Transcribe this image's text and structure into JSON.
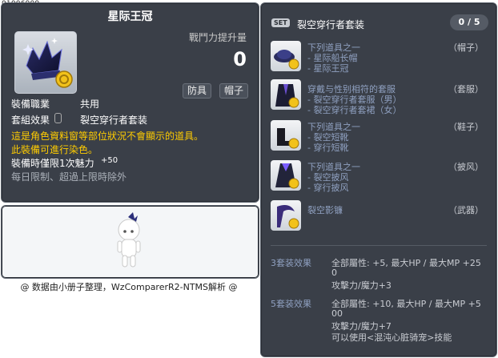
{
  "item_id": "01006909",
  "item": {
    "name": "星际王冠",
    "power_label": "戰鬥力提升量",
    "power_value": "0",
    "tags": [
      "防具",
      "帽子"
    ],
    "job_label": "裝備職業",
    "job_value": "共用",
    "set_label": "套組效果",
    "set_value": "裂空穿行者套装",
    "notice_lines": [
      "這是角色資料窗等部位狀況不會顯示的道具。",
      "此裝備可進行染色。"
    ],
    "charm_label": "裝備時僅限1次魅力",
    "charm_value": "+50",
    "limit_text": "每日限制、超過上限時除外"
  },
  "footer": "@ 数据由小册子整理，WzComparerR2-NTMS解析 @",
  "set_panel": {
    "badge": "SET",
    "name": "裂空穿行者套装",
    "count": "0 / 5",
    "items": [
      {
        "lines": [
          "下列道具之一",
          "- 星际船长帽",
          "- 星际王冠"
        ],
        "category": "（帽子）"
      },
      {
        "lines": [
          "穿戴与性别相符的套服",
          "- 裂空穿行者套服（男）",
          "- 裂空穿行者套裙（女）"
        ],
        "category": "（套服）"
      },
      {
        "lines": [
          "下列道具之一",
          "- 裂空短靴",
          "- 穿行短靴"
        ],
        "category": "（鞋子）"
      },
      {
        "lines": [
          "下列道具之一",
          "- 裂空披风",
          "- 穿行披风"
        ],
        "category": "（披风）"
      },
      {
        "lines": [
          "裂空影镰"
        ],
        "category": "（武器）"
      }
    ],
    "bonuses": [
      {
        "label": "3套装效果",
        "lines": [
          "全部屬性: +5, 最大HP / 最大MP   +25",
          "0",
          "攻擊力/魔力+3"
        ]
      },
      {
        "label": "5套装效果",
        "lines": [
          "全部屬性: +10, 最大HP / 最大MP   +5",
          "00",
          "攻擊力/魔力+7",
          "可以使用<混沌心脏骑宠>技能"
        ]
      }
    ]
  },
  "colors": {
    "panel_bg": "#3a3f48",
    "notice": "#ffcc00",
    "set_item_text": "#8fa0c0"
  },
  "icons": [
    "star-crown-icon",
    "coin-icon",
    "character-preview",
    "set-item-icons"
  ]
}
